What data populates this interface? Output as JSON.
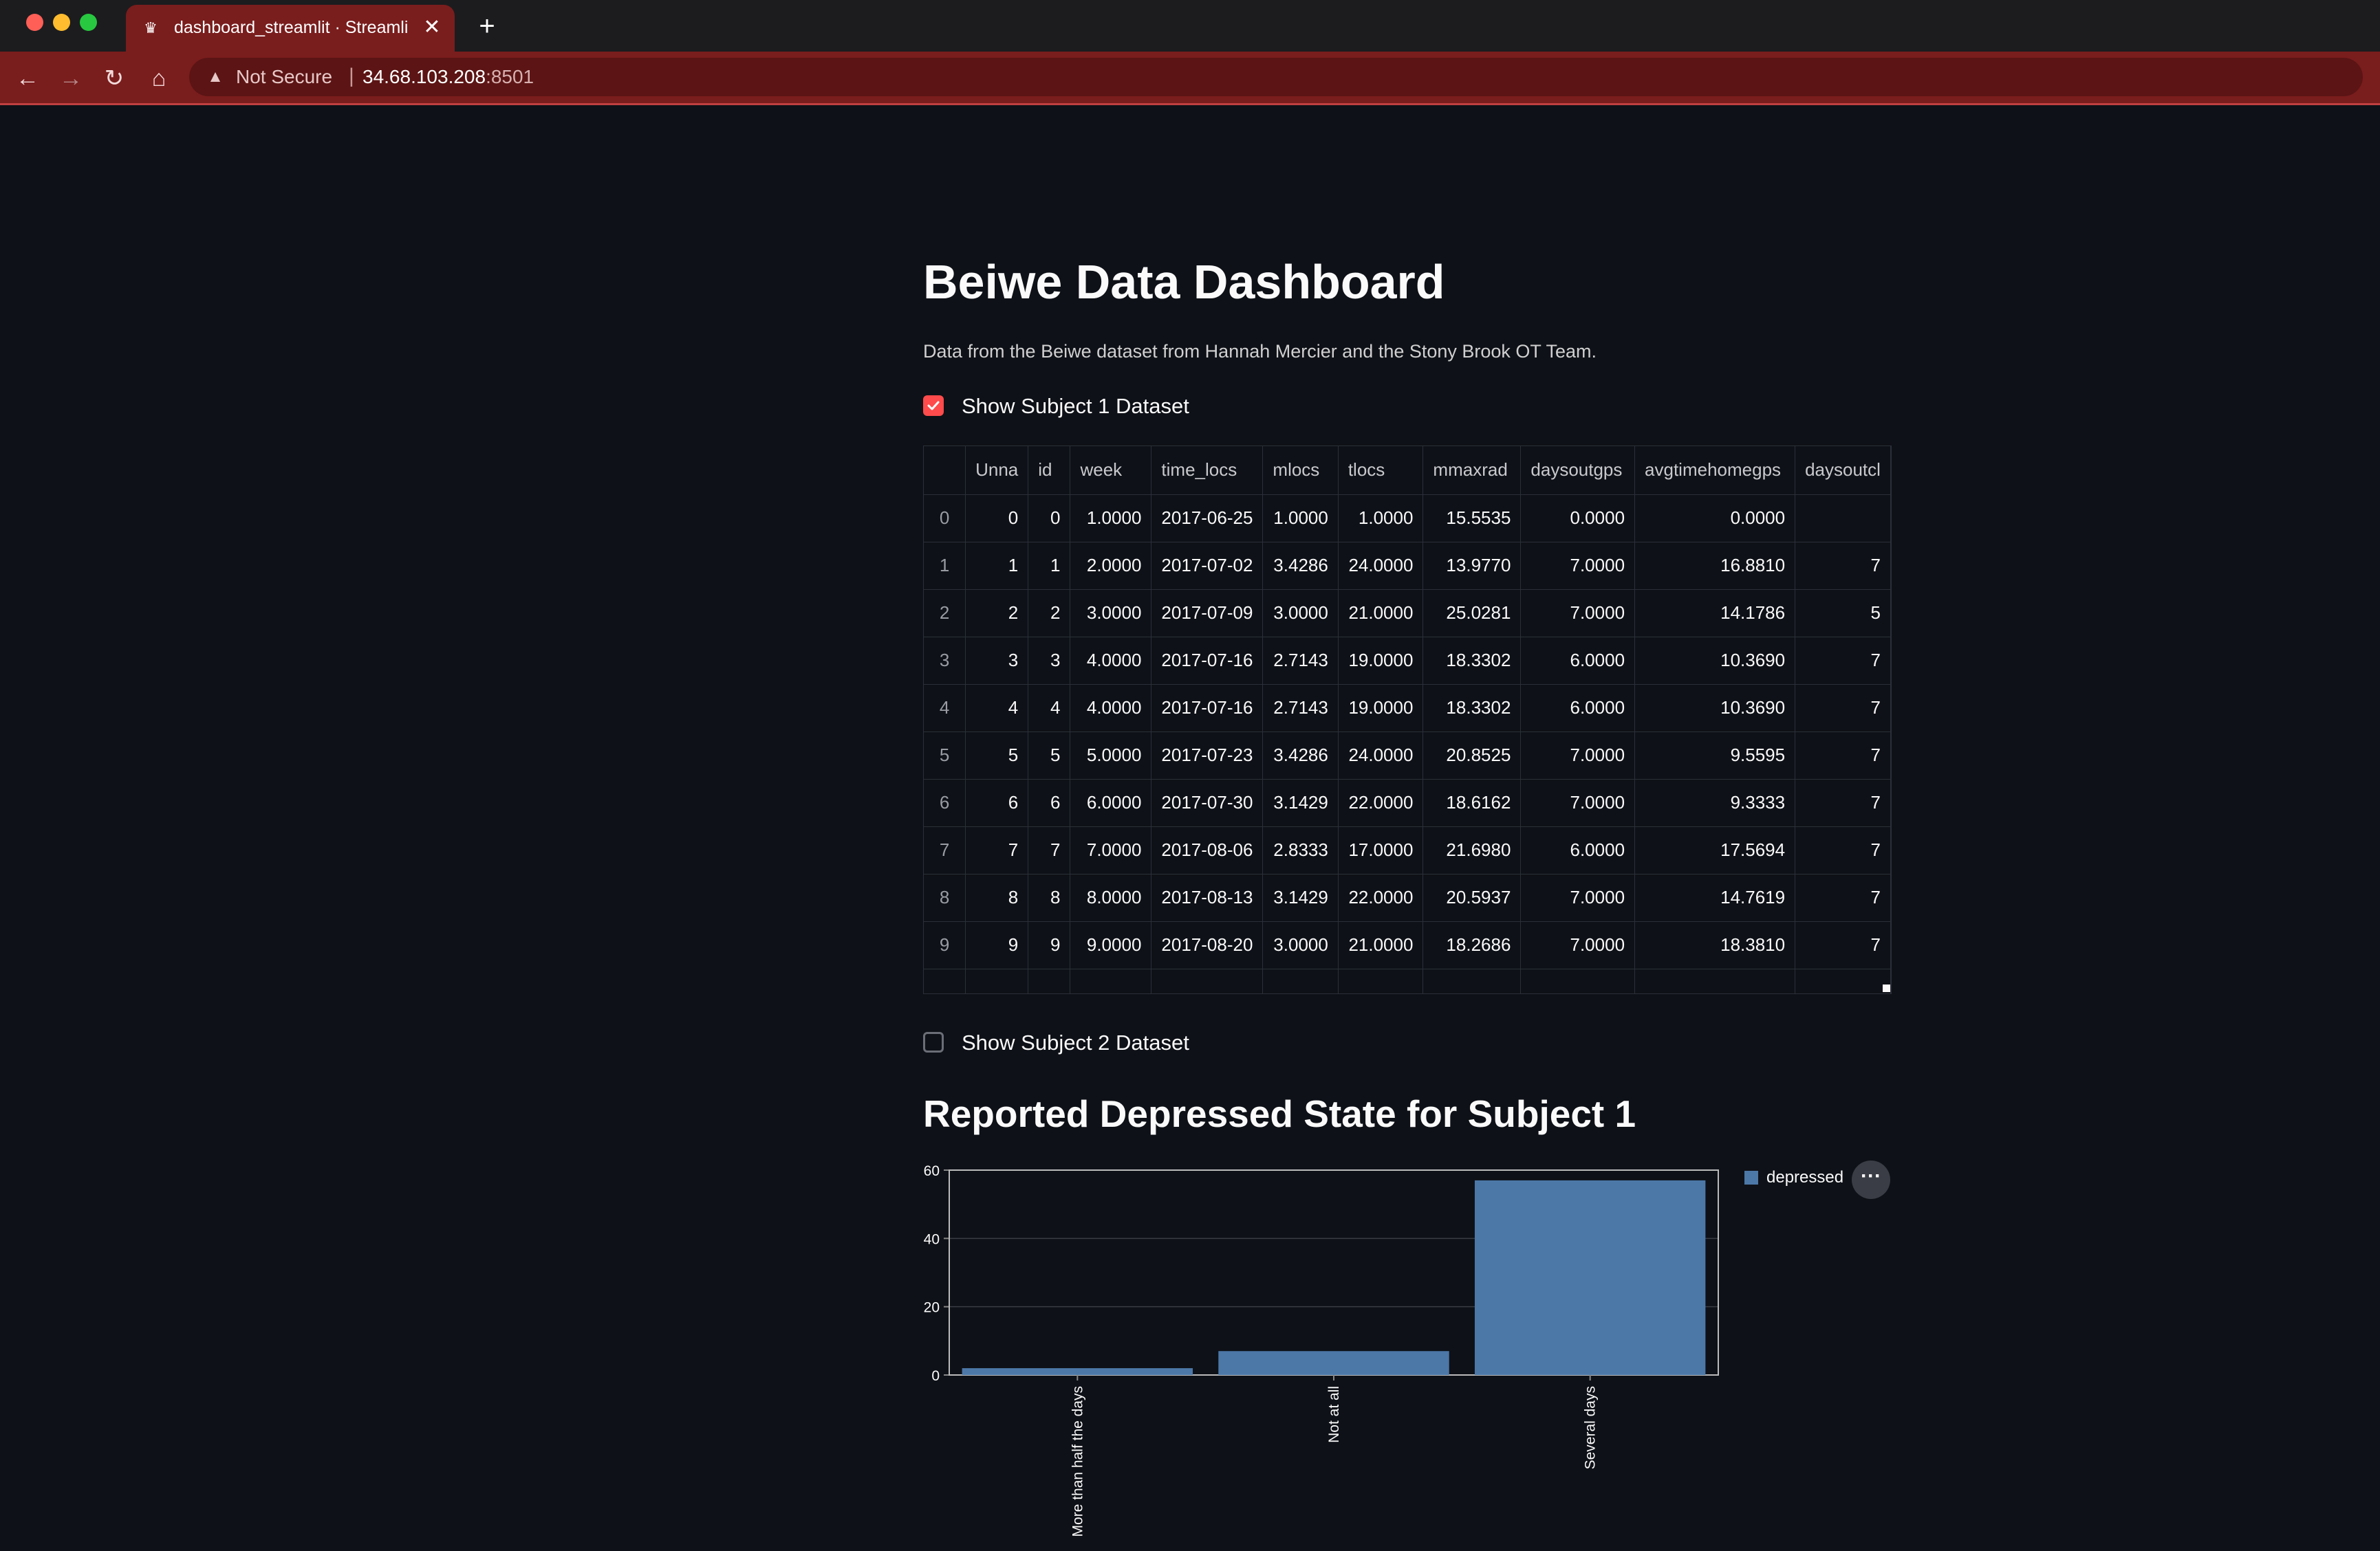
{
  "browser": {
    "tab_title": "dashboard_streamlit · Streamlit",
    "security_label": "Not Secure",
    "url_host": "34.68.103.208",
    "url_port": ":8501",
    "separator": "|"
  },
  "page": {
    "title": "Beiwe Data Dashboard",
    "subtitle": "Data from the Beiwe dataset from Hannah Mercier and the Stony Brook OT Team.",
    "checkbox1_label": "Show Subject 1 Dataset",
    "checkbox1_checked": true,
    "checkbox2_label": "Show Subject 2 Dataset",
    "checkbox2_checked": false,
    "chart_title": "Reported Depressed State for Subject 1"
  },
  "table": {
    "columns": [
      "",
      "Unna",
      "id",
      "week",
      "time_locs",
      "mlocs",
      "tlocs",
      "mmaxrad",
      "daysoutgps",
      "avgtimehomegps",
      "daysoutcl"
    ],
    "rows": [
      [
        "0",
        "0",
        "0",
        "1.0000",
        "2017-06-25",
        "1.0000",
        "1.0000",
        "15.5535",
        "0.0000",
        "0.0000",
        ""
      ],
      [
        "1",
        "1",
        "1",
        "2.0000",
        "2017-07-02",
        "3.4286",
        "24.0000",
        "13.9770",
        "7.0000",
        "16.8810",
        "7"
      ],
      [
        "2",
        "2",
        "2",
        "3.0000",
        "2017-07-09",
        "3.0000",
        "21.0000",
        "25.0281",
        "7.0000",
        "14.1786",
        "5"
      ],
      [
        "3",
        "3",
        "3",
        "4.0000",
        "2017-07-16",
        "2.7143",
        "19.0000",
        "18.3302",
        "6.0000",
        "10.3690",
        "7"
      ],
      [
        "4",
        "4",
        "4",
        "4.0000",
        "2017-07-16",
        "2.7143",
        "19.0000",
        "18.3302",
        "6.0000",
        "10.3690",
        "7"
      ],
      [
        "5",
        "5",
        "5",
        "5.0000",
        "2017-07-23",
        "3.4286",
        "24.0000",
        "20.8525",
        "7.0000",
        "9.5595",
        "7"
      ],
      [
        "6",
        "6",
        "6",
        "6.0000",
        "2017-07-30",
        "3.1429",
        "22.0000",
        "18.6162",
        "7.0000",
        "9.3333",
        "7"
      ],
      [
        "7",
        "7",
        "7",
        "7.0000",
        "2017-08-06",
        "2.8333",
        "17.0000",
        "21.6980",
        "6.0000",
        "17.5694",
        "7"
      ],
      [
        "8",
        "8",
        "8",
        "8.0000",
        "2017-08-13",
        "3.1429",
        "22.0000",
        "20.5937",
        "7.0000",
        "14.7619",
        "7"
      ],
      [
        "9",
        "9",
        "9",
        "9.0000",
        "2017-08-20",
        "3.0000",
        "21.0000",
        "18.2686",
        "7.0000",
        "18.3810",
        "7"
      ]
    ]
  },
  "chart_data": {
    "type": "bar",
    "categories": [
      "More than half the days",
      "Not at all",
      "Several days"
    ],
    "series": [
      {
        "name": "depressed",
        "values": [
          2,
          7,
          57
        ]
      }
    ],
    "ylim": [
      0,
      60
    ],
    "yticks": [
      0,
      20,
      40,
      60
    ],
    "legend_position": "top-right",
    "grid": true,
    "bar_color": "#4c78a8"
  },
  "icons": {
    "menu_glyph": "···",
    "close_glyph": "✕",
    "new_tab_glyph": "+"
  }
}
